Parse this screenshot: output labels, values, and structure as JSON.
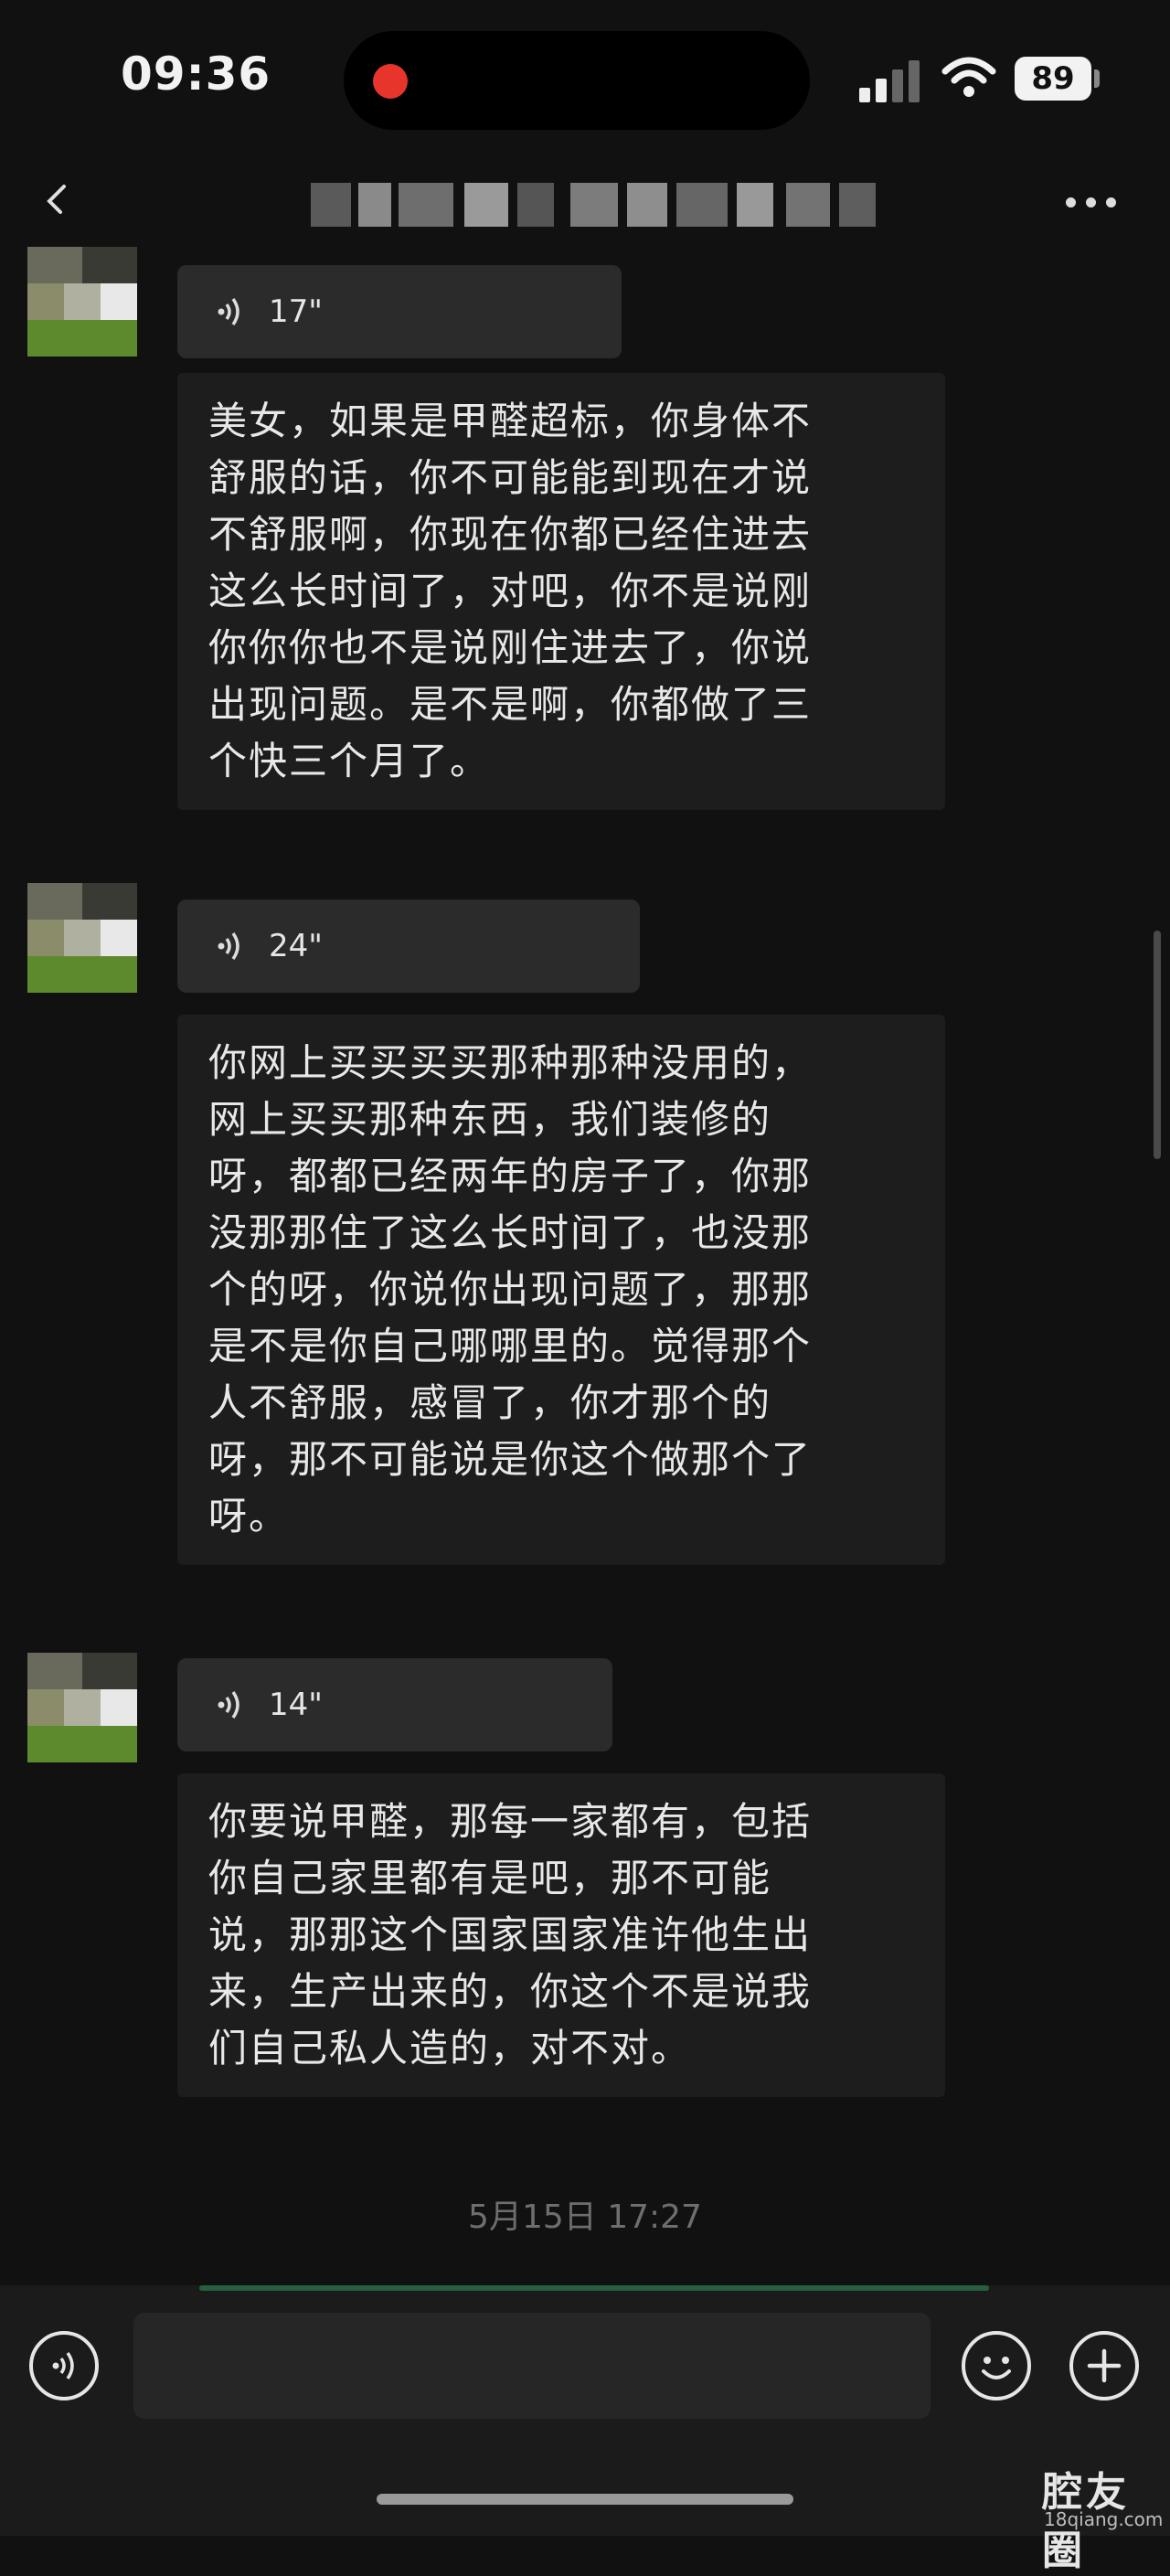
{
  "status_bar": {
    "time": "09:36",
    "battery": "89"
  },
  "chat": {
    "title": "",
    "messages": [
      {
        "duration": "17\"",
        "lines": [
          "美女，如果是甲醛超标，你身体不",
          "舒服的话，你不可能能到现在才说",
          "不舒服啊，你现在你都已经住进去",
          "这么长时间了，对吧，你不是说刚",
          "你你你也不是说刚住进去了，你说",
          "出现问题。是不是啊，你都做了三",
          "个快三个月了。"
        ]
      },
      {
        "duration": "24\"",
        "lines": [
          "你网上买买买买那种那种没用的，",
          "网上买买那种东西，我们装修的",
          "呀，都都已经两年的房子了，你那",
          "没那那住了这么长时间了，也没那",
          "个的呀，你说你出现问题了，那那",
          "是不是你自己哪哪里的。觉得那个",
          "人不舒服，感冒了，你才那个的",
          "呀，那不可能说是你这个做那个了",
          "呀。"
        ]
      },
      {
        "duration": "14\"",
        "lines": [
          "你要说甲醛，那每一家都有，包括",
          "你自己家里都有是吧，那不可能",
          "说，那那这个国家国家准许他生出",
          "来，生产出来的，你这个不是说我",
          "们自己私人造的，对不对。"
        ]
      }
    ],
    "timestamp": "5月15日 17:27"
  },
  "input": {
    "placeholder": ""
  },
  "watermark": {
    "brand": "腔友圈",
    "url": "18qiang.com"
  },
  "icons": {
    "back": "chevron-left-icon",
    "more": "more-dots-icon",
    "voice_toggle": "voice-icon",
    "emoji": "emoji-icon",
    "add": "plus-icon"
  }
}
